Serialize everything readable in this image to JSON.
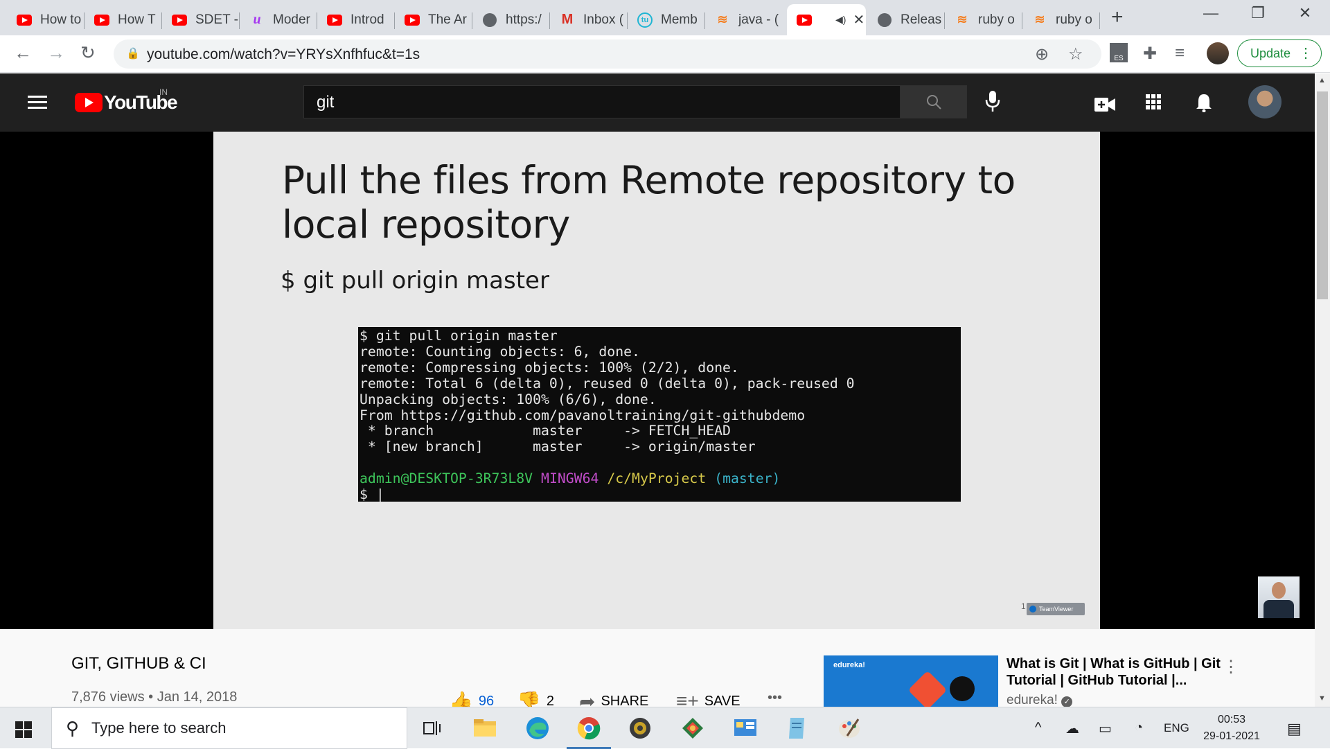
{
  "browser": {
    "tabs": [
      {
        "title": "How to",
        "icon": "youtube-icon"
      },
      {
        "title": "How T",
        "icon": "youtube-icon"
      },
      {
        "title": "SDET -",
        "icon": "youtube-icon"
      },
      {
        "title": "Moder",
        "icon": "udemy-icon"
      },
      {
        "title": "Introd",
        "icon": "youtube-icon"
      },
      {
        "title": "The Ar",
        "icon": "youtube-icon"
      },
      {
        "title": "https:/",
        "icon": "globe-icon"
      },
      {
        "title": "Inbox (",
        "icon": "gmail-icon"
      },
      {
        "title": "Memb",
        "icon": "toolsqa-icon"
      },
      {
        "title": "java - (",
        "icon": "stackoverflow-icon"
      },
      {
        "title": "",
        "icon": "youtube-icon",
        "active": true,
        "audio": true
      },
      {
        "title": "Releas",
        "icon": "globe-icon"
      },
      {
        "title": "ruby o",
        "icon": "stackoverflow-icon"
      },
      {
        "title": "ruby o",
        "icon": "stackoverflow-icon"
      }
    ],
    "url": "youtube.com/watch?v=YRYsXnfhfuc&t=1s",
    "update_label": "Update",
    "extension_badge": "ES"
  },
  "youtube": {
    "logo_text": "YouTube",
    "region": "IN",
    "search_query": "git"
  },
  "slide": {
    "title": "Pull the files from Remote repository to local repository",
    "command": "$ git pull origin master",
    "terminal_lines": [
      "$ git pull origin master",
      "remote: Counting objects: 6, done.",
      "remote: Compressing objects: 100% (2/2), done.",
      "remote: Total 6 (delta 0), reused 0 (delta 0), pack-reused 0",
      "Unpacking objects: 100% (6/6), done.",
      "From https://github.com/pavanoltraining/git-githubdemo",
      " * branch            master     -> FETCH_HEAD",
      " * [new branch]      master     -> origin/master"
    ],
    "prompt_user": "admin@DESKTOP-3R73L8V",
    "prompt_shell": "MINGW64",
    "prompt_path": "/c/MyProject",
    "prompt_branch": "(master)",
    "prompt_cursor": "$ |",
    "teamviewer_label": "TeamViewer",
    "page_number": "1"
  },
  "video": {
    "title": "GIT, GITHUB & CI",
    "views": "7,876 views",
    "date": "Jan 14, 2018",
    "meta_separator": " • ",
    "likes": "96",
    "dislikes": "2",
    "share_label": "SHARE",
    "save_label": "SAVE",
    "more_label": "•••"
  },
  "recommendation": {
    "thumb_brand": "edureka!",
    "title": "What is Git | What is GitHub | Git Tutorial | GitHub Tutorial |...",
    "channel": "edureka!"
  },
  "taskbar": {
    "search_placeholder": "Type here to search",
    "language": "ENG",
    "time": "00:53",
    "date": "29-01-2021"
  },
  "colors": {
    "youtube_red": "#ff0000",
    "yt_header_bg": "#202020",
    "slide_bg": "#e8e8e8",
    "terminal_bg": "#0c0c0c",
    "chrome_update_green": "#1e8e3e"
  }
}
